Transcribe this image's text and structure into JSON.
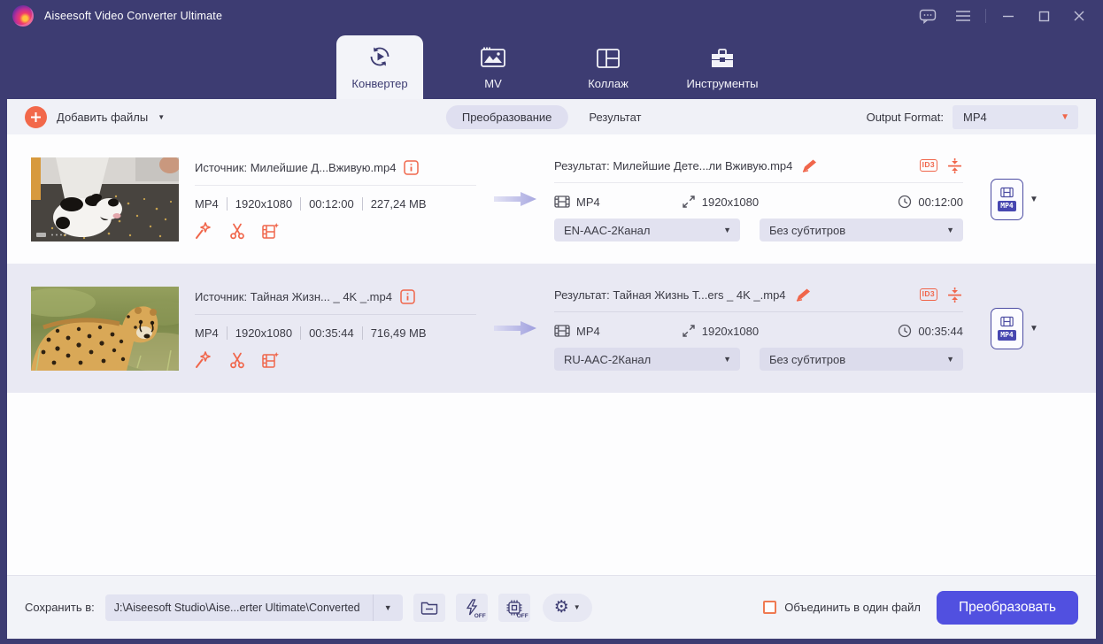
{
  "titlebar": {
    "title": "Aiseesoft Video Converter Ultimate"
  },
  "tabs": [
    {
      "label": "Конвертер",
      "active": true
    },
    {
      "label": "MV",
      "active": false
    },
    {
      "label": "Коллаж",
      "active": false
    },
    {
      "label": "Инструменты",
      "active": false
    }
  ],
  "toolbar": {
    "add_files_label": "Добавить файлы",
    "view_convert_label": "Преобразование",
    "view_result_label": "Результат",
    "output_format_label": "Output Format:",
    "output_format_value": "MP4"
  },
  "rows": [
    {
      "source_label": "Источник: Милейшие Д...Вживую.mp4",
      "info": {
        "format": "MP4",
        "resolution": "1920x1080",
        "duration": "00:12:00",
        "size": "227,24 MB"
      },
      "result_label": "Результат: Милейшие Дете...ли Вживую.mp4",
      "id3_label": "ID3",
      "out": {
        "format": "MP4",
        "resolution": "1920x1080",
        "duration": "00:12:00"
      },
      "audio_track": "EN-AAC-2Канал",
      "subtitle_track": "Без субтитров",
      "format_badge": "MP4"
    },
    {
      "source_label": "Источник: Тайная Жизн... _ 4K _.mp4",
      "info": {
        "format": "MP4",
        "resolution": "1920x1080",
        "duration": "00:35:44",
        "size": "716,49 MB"
      },
      "result_label": "Результат: Тайная Жизнь Т...ers _ 4K _.mp4",
      "id3_label": "ID3",
      "out": {
        "format": "MP4",
        "resolution": "1920x1080",
        "duration": "00:35:44"
      },
      "audio_track": "RU-AAC-2Канал",
      "subtitle_track": "Без субтитров",
      "format_badge": "MP4"
    }
  ],
  "bottombar": {
    "save_label": "Сохранить в:",
    "save_path": "J:\\Aiseesoft Studio\\Aise...erter Ultimate\\Converted",
    "hardware_off_label": "OFF",
    "gpu_off_label": "OFF",
    "merge_label": "Объединить в один файл",
    "convert_label": "Преобразовать"
  },
  "icons": {
    "feedback-icon": "speech-bubble with dots",
    "menu-icon": "hamburger lines",
    "minimize-icon": "–",
    "maximize-icon": "□",
    "close-icon": "✕",
    "converter-icon": "play circle with sync arrows",
    "mv-icon": "tv with picture",
    "collage-icon": "split layout grid",
    "tools-icon": "toolbox",
    "plus-icon": "+",
    "info-icon": "i",
    "wand-icon": "magic wand star",
    "cut-icon": "scissors",
    "enhance-icon": "film strip with star",
    "pencil-icon": "edit pen",
    "compress-icon": "arrows to line",
    "film-icon": "film strip",
    "expand-icon": "diagonal resize arrows",
    "clock-icon": "clock",
    "folder-icon": "folder",
    "lightning-icon": "bolt",
    "chip-icon": "cpu chip",
    "gear-icon": "⚙",
    "dropdown-arrow-icon": "▼"
  },
  "colors": {
    "indigo": "#3d3c72",
    "accent_orange": "#f0664b",
    "convert_button": "#5150e0",
    "selected_row": "#e9e9f3"
  }
}
